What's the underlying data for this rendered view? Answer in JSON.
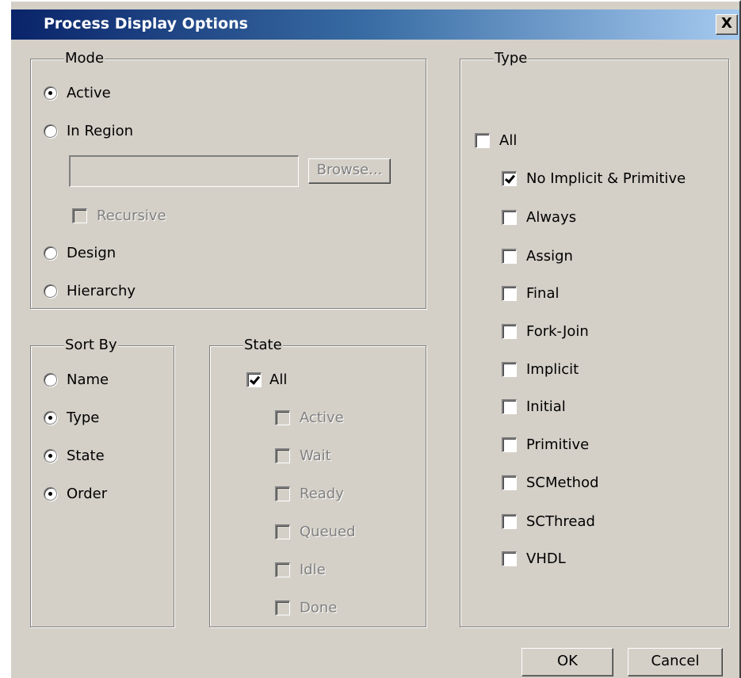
{
  "dialog": {
    "title": "Process Display Options",
    "close_glyph": "X"
  },
  "mode": {
    "label": "Mode",
    "options": [
      "Active",
      "In Region",
      "Design",
      "Hierarchy"
    ],
    "selected": "Active",
    "region_value": "",
    "browse_label": "Browse...",
    "recursive_label": "Recursive"
  },
  "sort_by": {
    "label": "Sort By",
    "options": [
      "Name",
      "Type",
      "State",
      "Order"
    ]
  },
  "state": {
    "label": "State",
    "all_label": "All",
    "items": [
      "Active",
      "Wait",
      "Ready",
      "Queued",
      "Idle",
      "Done"
    ]
  },
  "type": {
    "label": "Type",
    "all_label": "All",
    "items": [
      "No Implicit & Primitive",
      "Always",
      "Assign",
      "Final",
      "Fork-Join",
      "Implicit",
      "Initial",
      "Primitive",
      "SCMethod",
      "SCThread",
      "VHDL"
    ]
  },
  "buttons": {
    "ok": "OK",
    "cancel": "Cancel"
  }
}
